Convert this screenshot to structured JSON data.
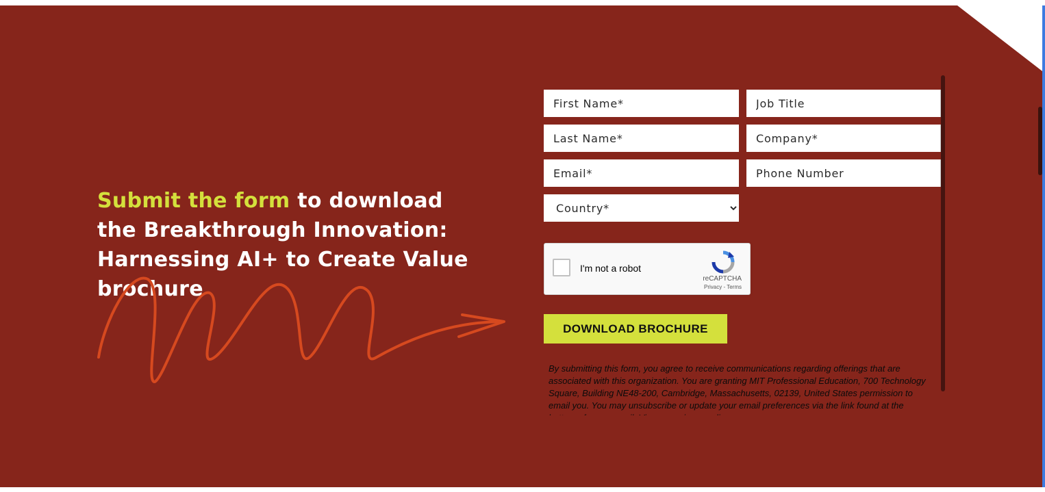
{
  "headline": {
    "highlight": "Submit the form",
    "rest": " to download the Breakthrough Innovation: Harnessing AI+ to Create Value brochure"
  },
  "form": {
    "first_name_placeholder": "First Name*",
    "job_title_placeholder": "Job Title",
    "last_name_placeholder": "Last Name*",
    "company_placeholder": "Company*",
    "email_placeholder": "Email*",
    "phone_placeholder": "Phone Number",
    "country_selected": "Country*",
    "captcha_label": "I'm not a robot",
    "captcha_brand": "reCAPTCHA",
    "captcha_terms": "Privacy - Terms",
    "submit_label": "DOWNLOAD BROCHURE",
    "disclaimer": "By submitting this form, you agree to receive communications regarding offerings that are associated with this organization. You are granting MIT Professional Education, 700 Technology Square, Building NE48-200, Cambridge, Massachusetts, 02139, United States permission to email you. You may unsubscribe or update your email preferences via the link found at the bottom of every email. View our privacy policy."
  },
  "colors": {
    "background": "#86251b",
    "accent": "#d4e03c",
    "arrow": "#d6491f"
  }
}
